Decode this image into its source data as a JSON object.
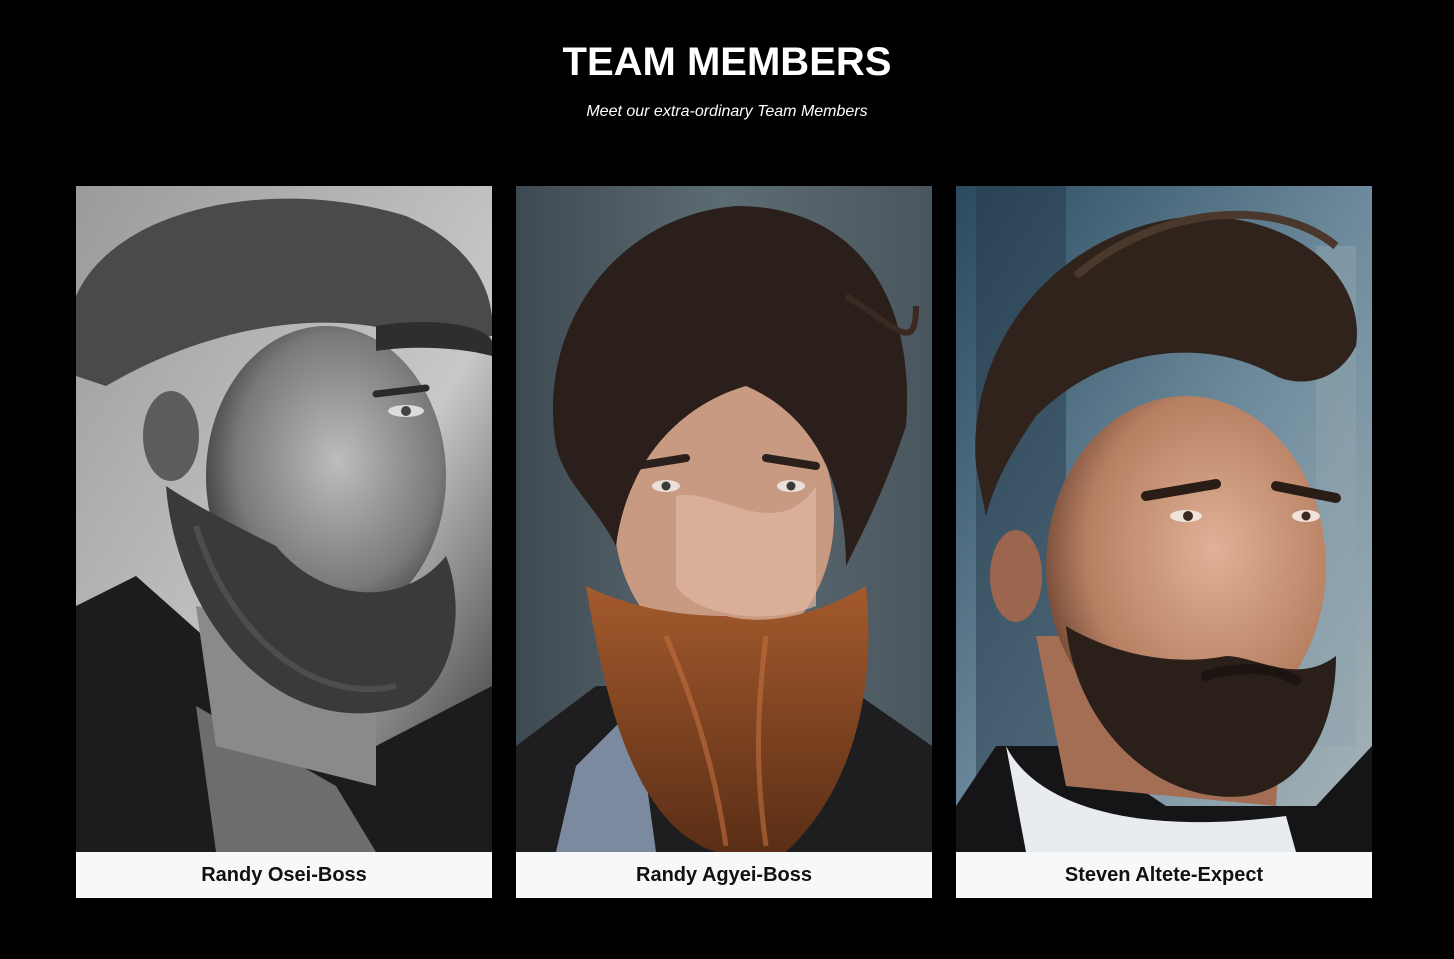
{
  "section": {
    "title": "TEAM MEMBERS",
    "subtitle": "Meet our extra-ordinary Team Members"
  },
  "members": [
    {
      "name": "Randy Osei-Boss"
    },
    {
      "name": "Randy Agyei-Boss"
    },
    {
      "name": "Steven Altete-Expect"
    }
  ],
  "colors": {
    "background": "#000000",
    "card_caption_bg": "#f7f8fa",
    "title_text": "#ffffff",
    "name_text": "#111111"
  }
}
